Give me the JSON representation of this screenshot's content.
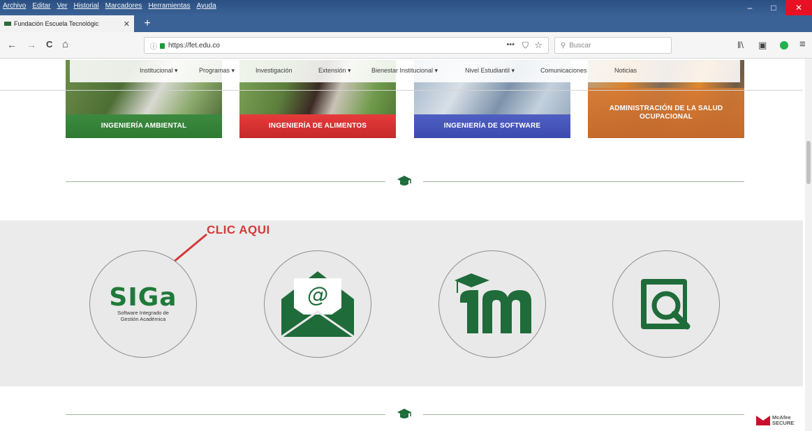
{
  "browser": {
    "menu": [
      "Archivo",
      "Editar",
      "Ver",
      "Historial",
      "Marcadores",
      "Herramientas",
      "Ayuda"
    ],
    "tab_title": "Fundación Escuela Tecnológic",
    "tab_close": "✕",
    "new_tab": "+",
    "url": "https://fet.edu.co",
    "url_info": "ⓘ",
    "url_dots": "•••",
    "url_pocket": "⛉",
    "url_star": "☆",
    "search_placeholder": "Buscar",
    "nav": {
      "back": "←",
      "forward": "→",
      "reload": "C",
      "home": "⌂"
    },
    "window_buttons": {
      "minimize": "–",
      "maximize": "□",
      "close": "✕"
    },
    "library_icon": "ǁ\\",
    "sidebar_icon": "▣",
    "menu_icon": "≡"
  },
  "site": {
    "nav": [
      "Institucional ▾",
      "Programas ▾",
      "Investigación",
      "Extensión ▾",
      "Bienestar Institucional ▾",
      "Nivel Estudiantil ▾",
      "Comunicaciones",
      "Noticias"
    ],
    "programs": [
      {
        "label": "INGENIERÍA AMBIENTAL"
      },
      {
        "label": "INGENIERÍA DE ALIMENTOS"
      },
      {
        "label": "INGENIERÍA DE SOFTWARE"
      },
      {
        "label": "ADMINISTRACIÓN DE LA SALUD OCUPACIONAL"
      }
    ],
    "annotation": "CLIC AQUI",
    "siga_logo": "SIGa",
    "siga_subtitle": "Software Integrado de Gestión Académica",
    "mcafee": [
      "McAfee",
      "SECURE"
    ]
  },
  "colors": {
    "accent_green": "#1f6b3a",
    "annotation_red": "#d33a3a",
    "band_gray": "#ebebeb"
  }
}
